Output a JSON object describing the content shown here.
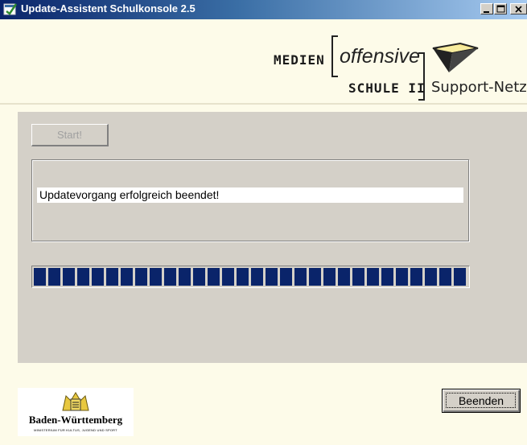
{
  "window": {
    "title": "Update-Assistent Schulkonsole 2.5",
    "icon": "app-icon",
    "controls": {
      "minimize": "minimize-icon",
      "maximize": "maximize-icon",
      "close": "close-icon"
    }
  },
  "header_logo": {
    "medien": "MEDIEN",
    "offensive": "offensive",
    "schule": "SCHULE II",
    "support": "Support-Netz"
  },
  "main": {
    "start_button": "Start!",
    "start_enabled": false,
    "status_text": "Updatevorgang erfolgreich beendet!",
    "progress_fraction": 1.0
  },
  "footer": {
    "state_logo_name": "Baden-Württemberg",
    "state_logo_subtitle": "MINISTERIUM FÜR KULTUS, JUGEND UND SPORT",
    "exit_button": "Beenden"
  },
  "colors": {
    "titlebar": "#0a246a",
    "background": "#fdfbe9",
    "panel": "#d4d0c8",
    "progress": "#0a246a"
  }
}
